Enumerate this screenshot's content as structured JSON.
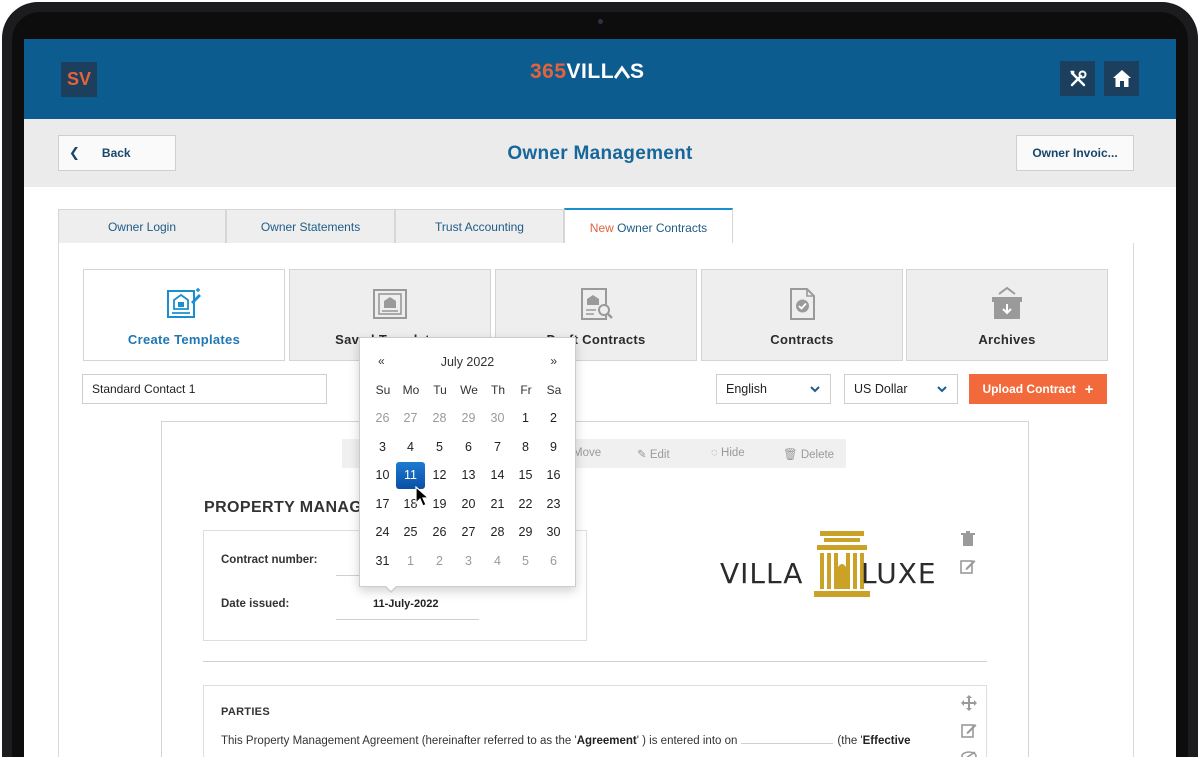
{
  "header": {
    "logo_initials": "SV",
    "brand_number": "365",
    "brand_word": "VILL^S",
    "tools_icon": "tools-icon",
    "home_icon": "home-icon"
  },
  "subheader": {
    "back_label": "Back",
    "title": "Owner Management",
    "invoice_label": "Owner Invoic..."
  },
  "tabs": [
    {
      "label": "Owner Login"
    },
    {
      "label": "Owner Statements"
    },
    {
      "label": "Trust Accounting"
    },
    {
      "label_prefix": "New",
      "label": "Owner Contracts",
      "active": true
    }
  ],
  "cards": [
    {
      "label": "Create Templates",
      "icon": "create-template-icon",
      "active": true
    },
    {
      "label": "Saved Templates",
      "icon": "saved-templates-icon"
    },
    {
      "label": "Draft Contracts",
      "icon": "draft-contracts-icon"
    },
    {
      "label": "Contracts",
      "icon": "contracts-icon"
    },
    {
      "label": "Archives",
      "icon": "archives-icon"
    }
  ],
  "form": {
    "template_name": "Standard Contact 1",
    "language": "English",
    "currency": "US Dollar",
    "upload_label": "Upload Contract"
  },
  "toolbar": {
    "move": "Move",
    "edit": "Edit",
    "hide": "Hide",
    "delete": "Delete"
  },
  "document": {
    "title": "PROPERTY MANAGEMENT AGREEMENT",
    "contract_number_label": "Contract number:",
    "date_issued_label": "Date issued:",
    "date_issued_value": "11-July-2022",
    "logo_left": "VILLA",
    "logo_right": "LUXE",
    "parties_title": "PARTIES",
    "parties_text_1": "This Property Management Agreement (hereinafter referred to as the '",
    "parties_bold_1": "Agreement",
    "parties_text_2": "' ) is entered into on",
    "parties_text_3": "(the '",
    "parties_bold_2": "Effective"
  },
  "datepicker": {
    "prev": "«",
    "next": "»",
    "month": "July 2022",
    "weekdays": [
      "Su",
      "Mo",
      "Tu",
      "We",
      "Th",
      "Fr",
      "Sa"
    ],
    "weeks": [
      [
        "26",
        "27",
        "28",
        "29",
        "30",
        "1",
        "2"
      ],
      [
        "3",
        "4",
        "5",
        "6",
        "7",
        "8",
        "9"
      ],
      [
        "10",
        "11",
        "12",
        "13",
        "14",
        "15",
        "16"
      ],
      [
        "17",
        "18",
        "19",
        "20",
        "21",
        "22",
        "23"
      ],
      [
        "24",
        "25",
        "26",
        "27",
        "28",
        "29",
        "30"
      ],
      [
        "31",
        "1",
        "2",
        "3",
        "4",
        "5",
        "6"
      ]
    ],
    "selected": "11"
  },
  "colors": {
    "header_blue": "#0d5c8f",
    "accent_orange": "#f26a3b",
    "title_blue": "#17679a",
    "selected_day": "#0b4fa6",
    "logo_gold": "#c9a227"
  }
}
